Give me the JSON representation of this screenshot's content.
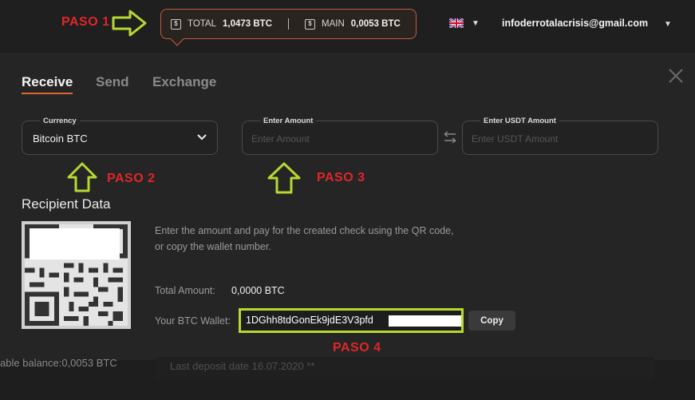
{
  "annotations": {
    "paso1": "PASO 1",
    "paso2": "PASO 2",
    "paso3": "PASO 3",
    "paso4": "PASO 4"
  },
  "header": {
    "total_label": "TOTAL",
    "total_value": "1,0473 BTC",
    "main_label": "MAIN",
    "main_value": "0,0053 BTC",
    "email": "infoderrotalacrisis@gmail.com"
  },
  "tabs": [
    {
      "label": "Receive",
      "active": true
    },
    {
      "label": "Send",
      "active": false
    },
    {
      "label": "Exchange",
      "active": false
    }
  ],
  "form": {
    "currency_label": "Currency",
    "currency_value": "Bitcoin BTC",
    "amount_label": "Enter Amount",
    "amount_placeholder": "Enter  Amount",
    "usdt_label": "Enter USDT Amount",
    "usdt_placeholder": "Enter USDT Amount"
  },
  "recipient": {
    "title": "Recipient Data",
    "description_line1": "Enter the amount and pay for the created check using the QR code,",
    "description_line2": "or copy the wallet number.",
    "total_amount_label": "Total Amount:",
    "total_amount_value": "0,0000 BTC",
    "wallet_label": "Your BTC Wallet:",
    "wallet_value": "1DGhh8tdGonEk9jdE3V3pfd",
    "copy_label": "Copy"
  },
  "background": {
    "balance_text": "able balance:0,0053 BTC",
    "deposit_text": "Last deposit date 16.07.2020 **"
  },
  "colors": {
    "accent": "#e0662e",
    "annotation_red": "#e0262a",
    "annotation_green": "#b5d931"
  }
}
